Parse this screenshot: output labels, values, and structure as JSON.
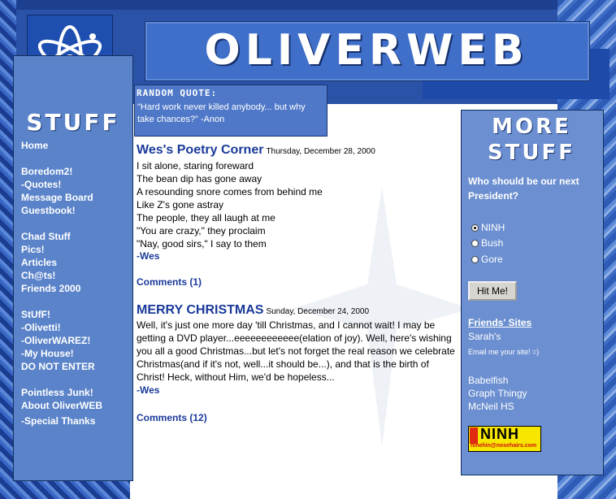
{
  "site": {
    "logo": "OLIVERWEB"
  },
  "quote": {
    "title": "RANDOM QUOTE:",
    "text": "\"Hard work never killed anybody... but why take chances?\" -Anon"
  },
  "left_sidebar": {
    "title": "STUFF",
    "links": [
      {
        "label": "Home"
      },
      {
        "label": "Boredom2!"
      },
      {
        "label": "-Quotes!"
      },
      {
        "label": "Message Board"
      },
      {
        "label": "Guestbook!"
      },
      {
        "label": "Chad Stuff"
      },
      {
        "label": "Pics!"
      },
      {
        "label": "Articles"
      },
      {
        "label": "Ch@ts!"
      },
      {
        "label": "Friends 2000"
      },
      {
        "label": "StUfF!"
      },
      {
        "label": "-Olivetti!"
      },
      {
        "label": "-OliverWAREZ!"
      },
      {
        "label": "-My House!"
      },
      {
        "label": "DO NOT ENTER"
      },
      {
        "label": "Pointless Junk!"
      },
      {
        "label": "About OliverWEB"
      },
      {
        "label": "-Special Thanks"
      }
    ]
  },
  "posts": [
    {
      "title": "Wes's Poetry Corner",
      "date": "Thursday, December 28, 2000",
      "lines": [
        "I sit alone, staring foreward",
        "The bean dip has gone away",
        "A resounding snore comes from behind me",
        "Like Z's gone astray",
        "The people, they all laugh at me",
        "\"You are crazy,\" they proclaim",
        "\"Nay, good sirs,\" I say to them"
      ],
      "signature": "-Wes",
      "comments": "Comments (1)"
    },
    {
      "title": "MERRY CHRISTMAS",
      "date": "Sunday, December 24, 2000",
      "body": "Well, it's just one more day 'till Christmas, and I cannot wait! I may be getting a DVD player...eeeeeeeeeeee(elation of joy). Well, here's wishing you all a good Christmas...but let's not forget the real reason we celebrate Christmas(and if it's not, well...it should be...), and that is the birth of Christ! Heck, without Him, we'd be hopeless...",
      "signature": "-Wes",
      "comments": "Comments (12)"
    }
  ],
  "right_sidebar": {
    "title_line1": "MORE",
    "title_line2": "STUFF",
    "poll": {
      "question": "Who should be our next President?",
      "options": [
        "NINH",
        "Bush",
        "Gore"
      ],
      "selected": "NINH",
      "button": "Hit Me!"
    },
    "friends_title": "Friends' Sites",
    "friend_first": "Sarah's",
    "email_note": "Email me your site! =)",
    "friends_more": [
      "Babelfish",
      "Graph Thingy",
      "McNeil HS"
    ],
    "banner": {
      "big": "NINH",
      "small": "ninehin@nosehairs.com"
    }
  }
}
